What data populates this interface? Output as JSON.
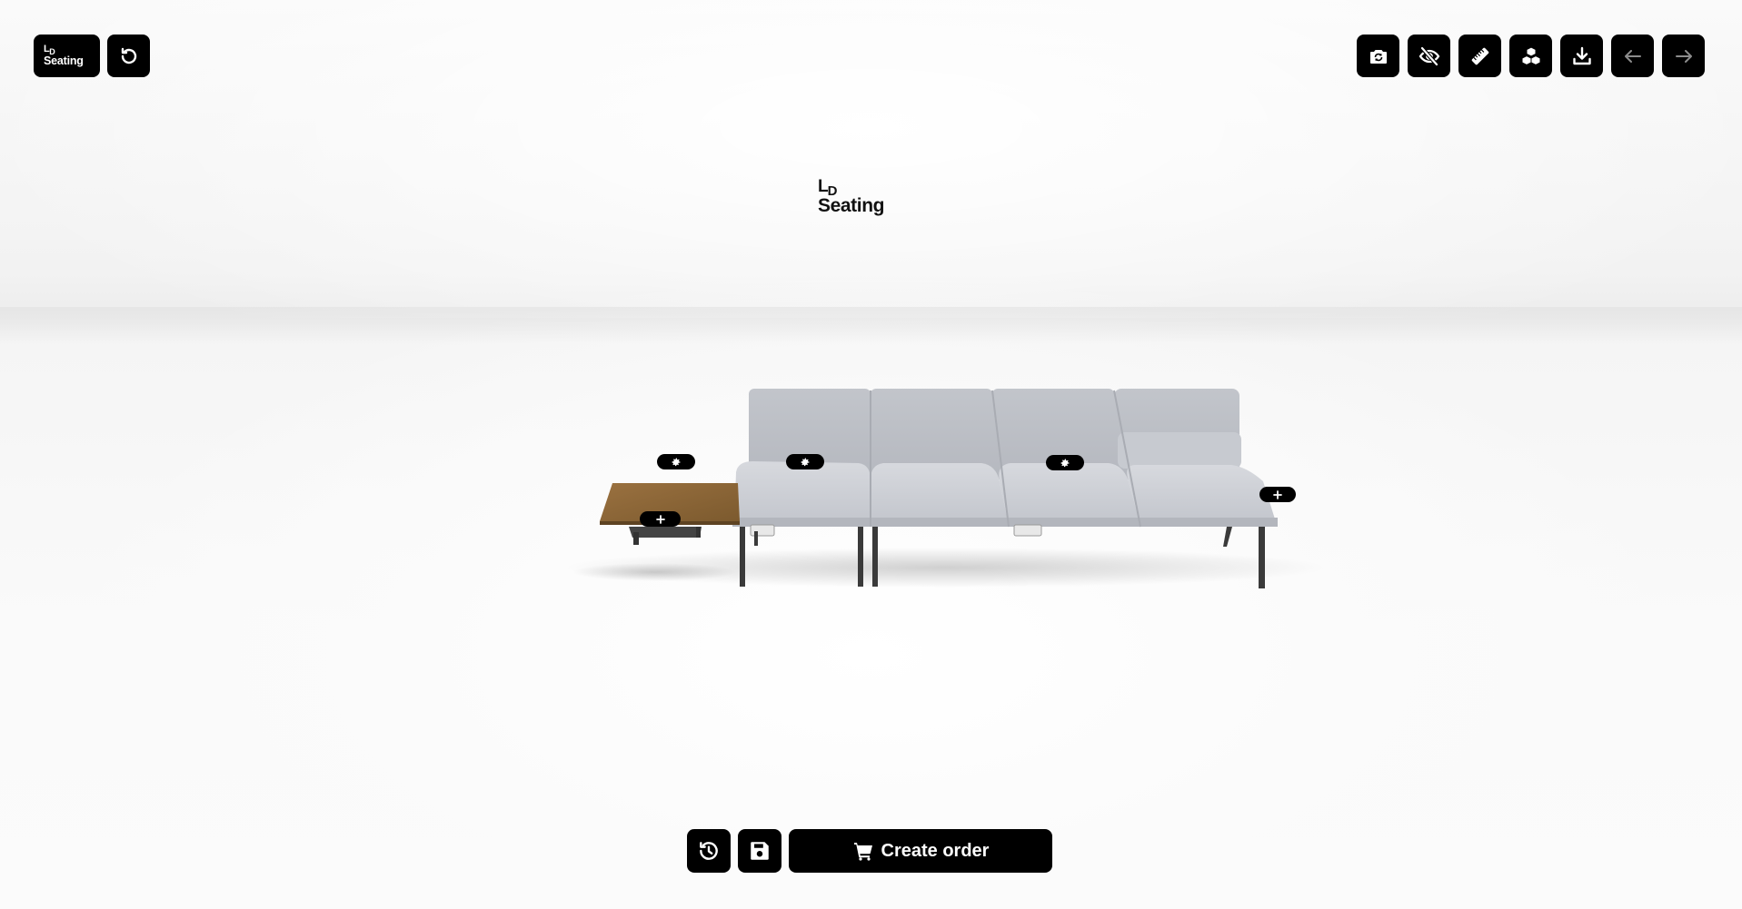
{
  "brand": {
    "logo_line1_l": "L",
    "logo_line1_d": "D",
    "logo_line2": "Seating"
  },
  "toolbar_left": {
    "reset_icon": "reset-icon"
  },
  "toolbar_right": {
    "icons": [
      "camera-rotate-icon",
      "eye-slash-icon",
      "ruler-icon",
      "cubes-icon",
      "download-icon",
      "arrow-left-icon",
      "arrow-right-icon"
    ]
  },
  "scene": {
    "config_icon": "gear-icon",
    "add_icon": "plus-icon",
    "seat_fabric_color": "#c9ccd2",
    "table_wood_color": "#8a6434",
    "leg_color": "#3a3a3a"
  },
  "bottom_bar": {
    "history_icon": "history-icon",
    "save_icon": "save-icon",
    "cart_icon": "cart-icon",
    "create_order_label": "Create order"
  }
}
